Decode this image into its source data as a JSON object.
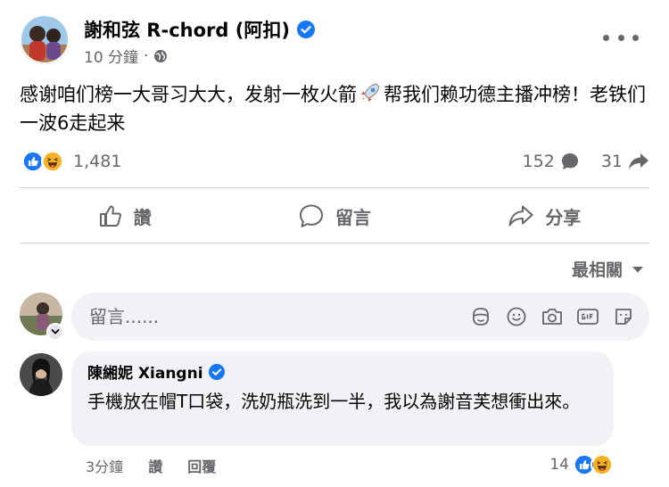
{
  "post": {
    "author": "謝和弦 R-chord (阿扣)",
    "time": "10 分鐘",
    "dot": "·",
    "text_before": "感谢咱们榜一大哥习大大，发射一枚火箭",
    "text_after": "帮我们赖功德主播冲榜！老铁们一波6走起来"
  },
  "stats": {
    "reaction_count": "1,481",
    "comment_count": "152",
    "share_count": "31"
  },
  "actions": {
    "like_label": "讚",
    "comment_label": "留言",
    "share_label": "分享"
  },
  "sort": {
    "label": "最相關"
  },
  "composer": {
    "placeholder": "留言......"
  },
  "comment": {
    "author": "陳緗妮 Xiangni",
    "text": "手機放在帽T口袋，洗奶瓶洗到一半，我以為謝音芙想衝出來。",
    "time": "3分鐘",
    "like_label": "讚",
    "reply_label": "回覆",
    "reaction_count": "14"
  },
  "colors": {
    "brand_blue": "#1877f2",
    "secondary_text": "#65676b",
    "bubble_bg": "#f0f2f5",
    "haha_yellow": "#f7b125"
  }
}
